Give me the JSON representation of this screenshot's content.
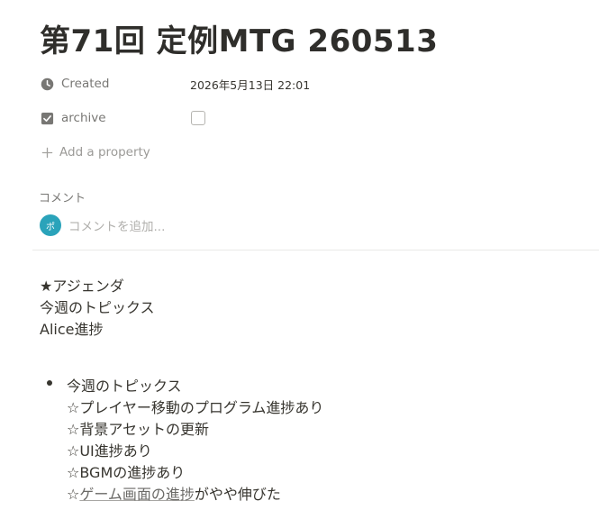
{
  "page": {
    "title": "第71回 定例MTG 260513"
  },
  "properties": {
    "created": {
      "icon": "clock-icon",
      "label": "Created",
      "value": "2026年5月13日 22:01"
    },
    "archive": {
      "icon": "checkbox-icon",
      "label": "archive",
      "checked": false
    },
    "add_property": {
      "icon": "plus-icon",
      "label": "Add a property"
    }
  },
  "comments": {
    "heading": "コメント",
    "avatar_text": "ポ",
    "placeholder": "コメントを追加..."
  },
  "content": {
    "lines": [
      "★アジェンダ",
      "今週のトピックス",
      "Alice進捗"
    ],
    "bullet": {
      "title": "今週のトピックス",
      "items": [
        "☆プレイヤー移動のプログラム進捗あり",
        "☆背景アセットの更新",
        "☆UI進捗あり",
        "☆BGMの進捗あり"
      ],
      "last_prefix": "☆",
      "last_link": "ゲーム画面の進捗",
      "last_suffix": "がやや伸びた"
    }
  },
  "colors": {
    "title": "#2f2e2b",
    "muted": "#787774",
    "avatar": "#2aa3ba",
    "text": "#37352f"
  }
}
